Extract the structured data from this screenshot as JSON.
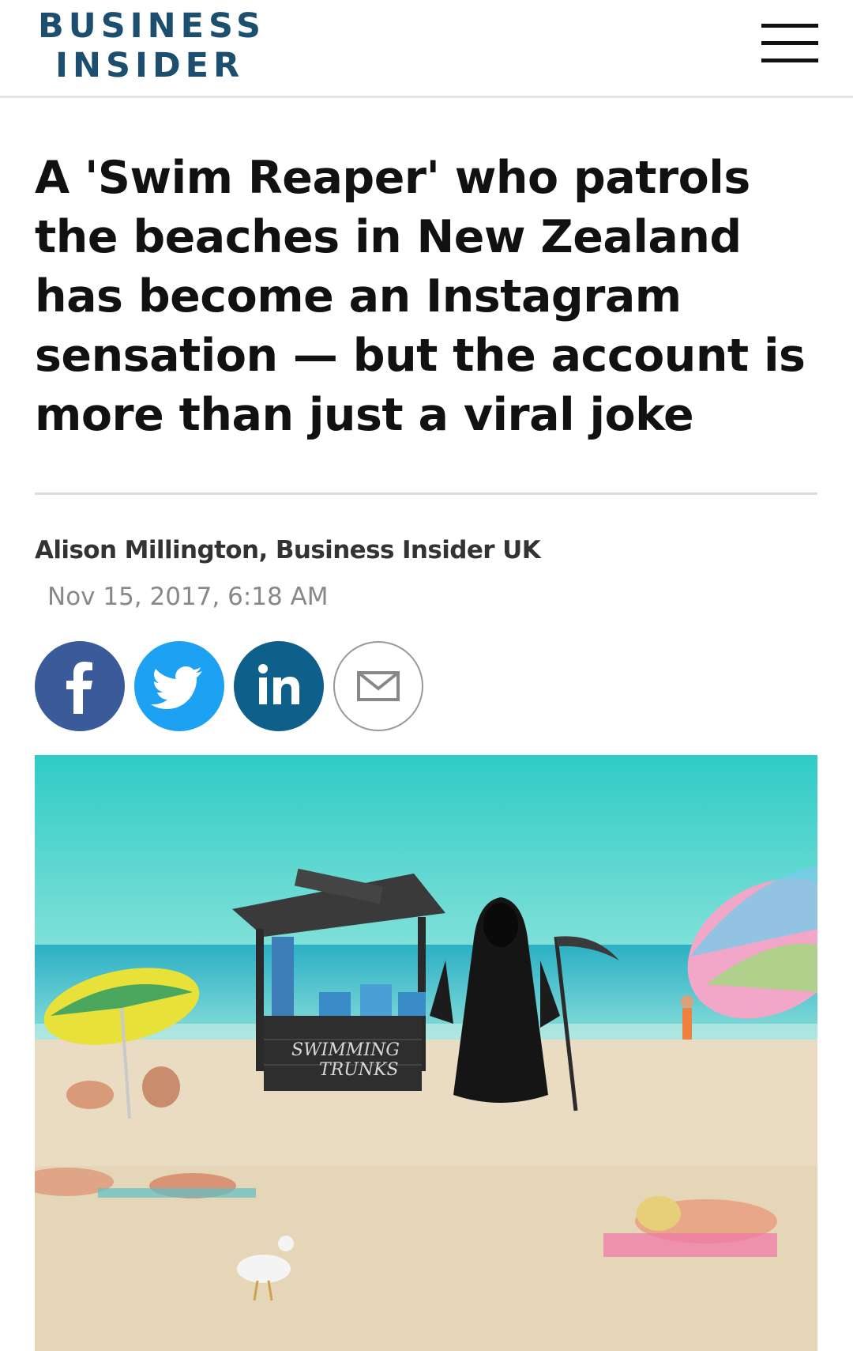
{
  "header": {
    "logo_line1": "BUSINESS",
    "logo_line2": "INSIDER",
    "logo_color": "#1b4e6f",
    "menu_icon": "hamburger-menu-icon"
  },
  "article": {
    "headline": "A 'Swim Reaper' who patrols the beaches in New Zealand has become an Instagram sensation — but the account is more than just a viral joke",
    "byline": "Alison Millington, Business Insider UK",
    "date": "Nov 15, 2017, 6:18 AM"
  },
  "share": {
    "buttons": [
      {
        "name": "facebook",
        "icon": "facebook-icon",
        "color": "#3a5a99"
      },
      {
        "name": "twitter",
        "icon": "twitter-icon",
        "color": "#1da1f2"
      },
      {
        "name": "linkedin",
        "icon": "linkedin-icon",
        "color": "#0e5f8a"
      },
      {
        "name": "email",
        "icon": "mail-icon",
        "color": "#999999"
      }
    ]
  },
  "hero_image": {
    "stall_sign_line1": "SWIMMING",
    "stall_sign_line2": "TRUNKS"
  }
}
